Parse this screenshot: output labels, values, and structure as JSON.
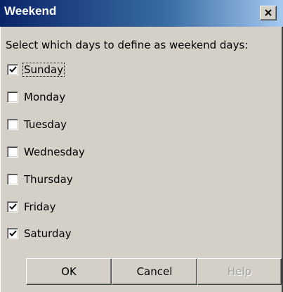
{
  "window": {
    "title": "Weekend"
  },
  "icons": {
    "close": "close-icon",
    "check": "checkmark-icon"
  },
  "colors": {
    "titlebar_start": "#0a246a",
    "titlebar_end": "#a6caf0",
    "face": "#d4d0c8"
  },
  "prompt": "Select which days to define as weekend days:",
  "days": [
    {
      "label": "Sunday",
      "checked": true,
      "focused": true
    },
    {
      "label": "Monday",
      "checked": false,
      "focused": false
    },
    {
      "label": "Tuesday",
      "checked": false,
      "focused": false
    },
    {
      "label": "Wednesday",
      "checked": false,
      "focused": false
    },
    {
      "label": "Thursday",
      "checked": false,
      "focused": false
    },
    {
      "label": "Friday",
      "checked": true,
      "focused": false
    },
    {
      "label": "Saturday",
      "checked": true,
      "focused": false
    }
  ],
  "buttons": {
    "ok": "OK",
    "cancel": "Cancel",
    "help": "Help",
    "help_enabled": false
  }
}
